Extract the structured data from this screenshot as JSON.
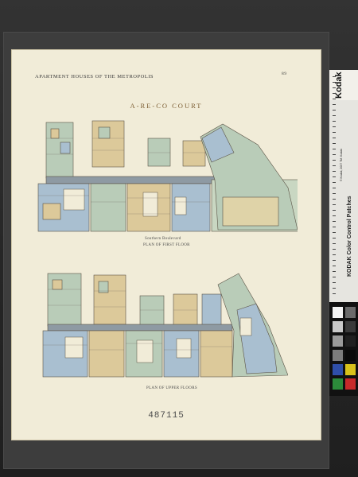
{
  "sheet": {
    "running_head": "APARTMENT HOUSES OF THE METROPOLIS",
    "page_number": "89",
    "title": "A-RE-CO COURT",
    "first_plan_street": "Southern Boulevard",
    "first_plan_caption": "PLAN OF FIRST FLOOR",
    "upper_plan_caption": "PLAN OF UPPER FLOORS",
    "plate_number": "487115"
  },
  "color_target": {
    "brand": "Kodak",
    "title": "KODAK Color Control Patches",
    "copyright": "© Kodak, 2007 TM: Kodak",
    "patch_colors": [
      "#f4f4f4",
      "#6b6b6b",
      "#c9c9c9",
      "#3a3a3a",
      "#9a9a9a",
      "#202020",
      "#7d7d7d",
      "#0a0a0a",
      "#2f4fa8",
      "#d8c21a",
      "#2c8a3a",
      "#c62a2a"
    ]
  },
  "colors": {
    "paper": "#f1ecd8",
    "room_green": "#b9ccb8",
    "room_tan": "#dcc99a",
    "room_blue": "#a9bfd0",
    "corridor": "#8e9aa3"
  }
}
